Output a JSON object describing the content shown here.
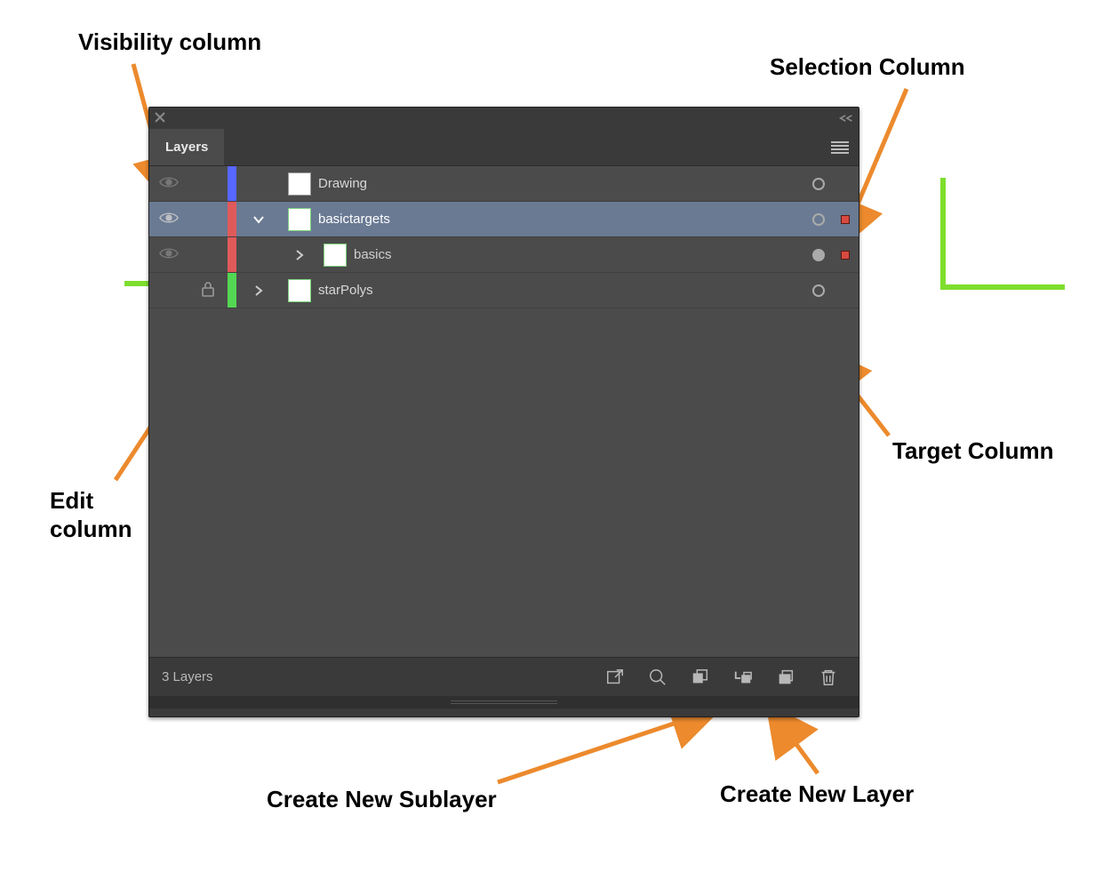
{
  "annotations": {
    "visibility": "Visibility column",
    "selection": "Selection Column",
    "edit": "Edit column",
    "target": "Target Column",
    "new_sublayer": "Create New Sublayer",
    "new_layer": "Create New Layer"
  },
  "panel": {
    "tab_label": "Layers",
    "footer": {
      "count_label": "3 Layers"
    }
  },
  "layers": [
    {
      "name": "Drawing",
      "color": "#5767ff",
      "visible": true,
      "locked": false,
      "expanded": null,
      "selected": false,
      "targeted": false,
      "sel_square": false,
      "indent": 0,
      "expand_icon": "none"
    },
    {
      "name": "basictargets",
      "color": "#e05a5a",
      "visible": true,
      "locked": false,
      "expanded": true,
      "selected": true,
      "targeted": false,
      "sel_square": true,
      "indent": 0,
      "expand_icon": "down"
    },
    {
      "name": "basics",
      "color": "#e05a5a",
      "visible": true,
      "locked": false,
      "expanded": false,
      "selected": false,
      "targeted": true,
      "sel_square": true,
      "indent": 40,
      "expand_icon": "right"
    },
    {
      "name": "starPolys",
      "color": "#53d653",
      "visible": false,
      "locked": true,
      "expanded": false,
      "selected": false,
      "targeted": false,
      "sel_square": false,
      "indent": 0,
      "expand_icon": "right"
    }
  ]
}
